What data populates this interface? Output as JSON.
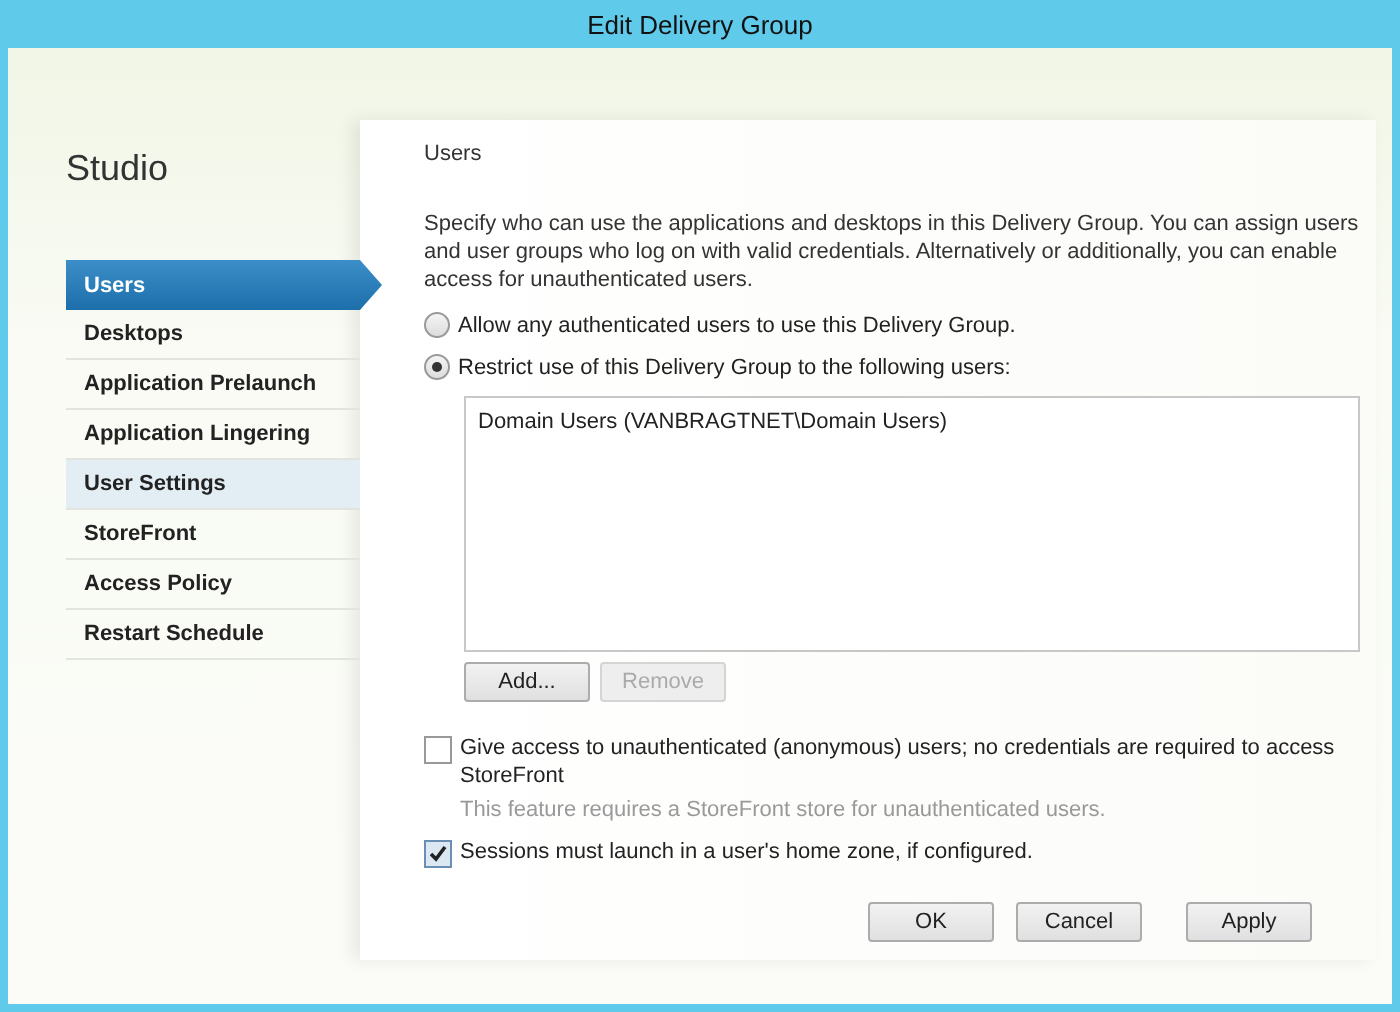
{
  "window": {
    "title": "Edit Delivery Group"
  },
  "sidebar": {
    "title": "Studio",
    "items": [
      {
        "label": "Users",
        "selected": true,
        "hovered": false
      },
      {
        "label": "Desktops",
        "selected": false,
        "hovered": false
      },
      {
        "label": "Application Prelaunch",
        "selected": false,
        "hovered": false
      },
      {
        "label": "Application Lingering",
        "selected": false,
        "hovered": false
      },
      {
        "label": "User Settings",
        "selected": false,
        "hovered": true
      },
      {
        "label": "StoreFront",
        "selected": false,
        "hovered": false
      },
      {
        "label": "Access Policy",
        "selected": false,
        "hovered": false
      },
      {
        "label": "Restart Schedule",
        "selected": false,
        "hovered": false
      }
    ]
  },
  "page": {
    "heading": "Users",
    "description": "Specify who can use the applications and desktops in this Delivery Group. You can assign users and user groups who log on with valid credentials. Alternatively or additionally, you can enable access for unauthenticated users.",
    "radios": [
      {
        "label": "Allow any authenticated users to use this Delivery Group.",
        "selected": false
      },
      {
        "label": "Restrict use of this Delivery Group to the following users:",
        "selected": true
      }
    ],
    "user_list": [
      "Domain Users (VANBRAGTNET\\Domain Users)"
    ],
    "list_buttons": [
      {
        "label": "Add...",
        "disabled": false
      },
      {
        "label": "Remove",
        "disabled": true
      }
    ],
    "checkboxes": [
      {
        "label": "Give access to unauthenticated (anonymous) users; no credentials are required to access StoreFront",
        "note": "This feature requires a StoreFront store for unauthenticated users.",
        "checked": false
      },
      {
        "label": "Sessions must launch in a user's home zone, if configured.",
        "checked": true
      }
    ]
  },
  "buttons": [
    "OK",
    "Cancel",
    "Apply"
  ]
}
